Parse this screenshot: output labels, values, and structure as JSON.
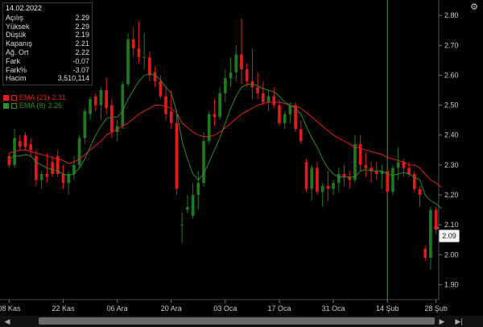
{
  "chart_data": {
    "type": "candlestick",
    "x_tick_labels": [
      "08 Kas",
      "22 Kas",
      "06 Ara",
      "20 Ara",
      "03 Oca",
      "17 Oca",
      "31 Oca",
      "14 Şub",
      "28 Şub"
    ],
    "y_ticks": [
      1.9,
      2.0,
      2.1,
      2.2,
      2.3,
      2.4,
      2.5,
      2.6,
      2.7,
      2.8
    ],
    "ylim": [
      1.85,
      2.83
    ],
    "grid": false,
    "up_color": "#1f7a1f",
    "down_color": "#e01b1b",
    "series": [
      {
        "name": "EMA (21)",
        "value": "2.31",
        "color": "#e02020"
      },
      {
        "name": "EMA (8)",
        "value": "2.26",
        "color": "#2e8b2e"
      }
    ],
    "candles": [
      {
        "o": 2.33,
        "h": 2.34,
        "l": 2.29,
        "c": 2.3
      },
      {
        "o": 2.3,
        "h": 2.42,
        "l": 2.29,
        "c": 2.39
      },
      {
        "o": 2.38,
        "h": 2.4,
        "l": 2.35,
        "c": 2.36
      },
      {
        "o": 2.4,
        "h": 2.41,
        "l": 2.35,
        "c": 2.36
      },
      {
        "o": 2.37,
        "h": 2.39,
        "l": 2.33,
        "c": 2.35
      },
      {
        "o": 2.33,
        "h": 2.35,
        "l": 2.23,
        "c": 2.25
      },
      {
        "o": 2.25,
        "h": 2.28,
        "l": 2.22,
        "c": 2.27
      },
      {
        "o": 2.27,
        "h": 2.34,
        "l": 2.24,
        "c": 2.26
      },
      {
        "o": 2.31,
        "h": 2.33,
        "l": 2.26,
        "c": 2.27
      },
      {
        "o": 2.33,
        "h": 2.35,
        "l": 2.26,
        "c": 2.27
      },
      {
        "o": 2.27,
        "h": 2.3,
        "l": 2.22,
        "c": 2.24
      },
      {
        "o": 2.24,
        "h": 2.28,
        "l": 2.2,
        "c": 2.27
      },
      {
        "o": 2.27,
        "h": 2.33,
        "l": 2.25,
        "c": 2.3
      },
      {
        "o": 2.3,
        "h": 2.4,
        "l": 2.29,
        "c": 2.39
      },
      {
        "o": 2.39,
        "h": 2.49,
        "l": 2.37,
        "c": 2.48
      },
      {
        "o": 2.47,
        "h": 2.53,
        "l": 2.45,
        "c": 2.52
      },
      {
        "o": 2.53,
        "h": 2.54,
        "l": 2.48,
        "c": 2.5
      },
      {
        "o": 2.5,
        "h": 2.56,
        "l": 2.45,
        "c": 2.55
      },
      {
        "o": 2.55,
        "h": 2.59,
        "l": 2.47,
        "c": 2.49
      },
      {
        "o": 2.5,
        "h": 2.52,
        "l": 2.39,
        "c": 2.41
      },
      {
        "o": 2.41,
        "h": 2.45,
        "l": 2.38,
        "c": 2.43
      },
      {
        "o": 2.43,
        "h": 2.58,
        "l": 2.42,
        "c": 2.57
      },
      {
        "o": 2.57,
        "h": 2.74,
        "l": 2.56,
        "c": 2.72
      },
      {
        "o": 2.72,
        "h": 2.76,
        "l": 2.66,
        "c": 2.69
      },
      {
        "o": 2.69,
        "h": 2.78,
        "l": 2.64,
        "c": 2.66
      },
      {
        "o": 2.66,
        "h": 2.74,
        "l": 2.62,
        "c": 2.66
      },
      {
        "o": 2.66,
        "h": 2.68,
        "l": 2.58,
        "c": 2.6
      },
      {
        "o": 2.61,
        "h": 2.63,
        "l": 2.56,
        "c": 2.58
      },
      {
        "o": 2.58,
        "h": 2.6,
        "l": 2.52,
        "c": 2.53
      },
      {
        "o": 2.53,
        "h": 2.56,
        "l": 2.45,
        "c": 2.47
      },
      {
        "o": 2.48,
        "h": 2.55,
        "l": 2.42,
        "c": 2.44
      },
      {
        "o": 2.44,
        "h": 2.47,
        "l": 2.2,
        "c": 2.22
      },
      {
        "o": 2.1,
        "h": 2.14,
        "l": 2.04,
        "c": 2.1
      },
      {
        "o": 2.15,
        "h": 2.2,
        "l": 2.14,
        "c": 2.16
      },
      {
        "o": 2.13,
        "h": 2.24,
        "l": 2.12,
        "c": 2.2
      },
      {
        "o": 2.2,
        "h": 2.28,
        "l": 2.15,
        "c": 2.24
      },
      {
        "o": 2.24,
        "h": 2.41,
        "l": 2.23,
        "c": 2.38
      },
      {
        "o": 2.38,
        "h": 2.48,
        "l": 2.37,
        "c": 2.47
      },
      {
        "o": 2.47,
        "h": 2.52,
        "l": 2.43,
        "c": 2.46
      },
      {
        "o": 2.46,
        "h": 2.56,
        "l": 2.45,
        "c": 2.54
      },
      {
        "o": 2.54,
        "h": 2.62,
        "l": 2.51,
        "c": 2.59
      },
      {
        "o": 2.59,
        "h": 2.66,
        "l": 2.56,
        "c": 2.61
      },
      {
        "o": 2.61,
        "h": 2.7,
        "l": 2.58,
        "c": 2.67
      },
      {
        "o": 2.67,
        "h": 2.79,
        "l": 2.57,
        "c": 2.62
      },
      {
        "o": 2.62,
        "h": 2.64,
        "l": 2.56,
        "c": 2.58
      },
      {
        "o": 2.58,
        "h": 2.69,
        "l": 2.52,
        "c": 2.56
      },
      {
        "o": 2.56,
        "h": 2.61,
        "l": 2.52,
        "c": 2.54
      },
      {
        "o": 2.54,
        "h": 2.58,
        "l": 2.5,
        "c": 2.51
      },
      {
        "o": 2.51,
        "h": 2.55,
        "l": 2.48,
        "c": 2.53
      },
      {
        "o": 2.53,
        "h": 2.56,
        "l": 2.49,
        "c": 2.5
      },
      {
        "o": 2.5,
        "h": 2.52,
        "l": 2.43,
        "c": 2.44
      },
      {
        "o": 2.44,
        "h": 2.48,
        "l": 2.42,
        "c": 2.47
      },
      {
        "o": 2.47,
        "h": 2.51,
        "l": 2.44,
        "c": 2.5
      },
      {
        "o": 2.5,
        "h": 2.51,
        "l": 2.41,
        "c": 2.42
      },
      {
        "o": 2.42,
        "h": 2.45,
        "l": 2.37,
        "c": 2.38
      },
      {
        "o": 2.31,
        "h": 2.32,
        "l": 2.21,
        "c": 2.22
      },
      {
        "o": 2.22,
        "h": 2.3,
        "l": 2.18,
        "c": 2.29
      },
      {
        "o": 2.29,
        "h": 2.31,
        "l": 2.2,
        "c": 2.21
      },
      {
        "o": 2.21,
        "h": 2.24,
        "l": 2.16,
        "c": 2.23
      },
      {
        "o": 2.23,
        "h": 2.28,
        "l": 2.18,
        "c": 2.22
      },
      {
        "o": 2.22,
        "h": 2.25,
        "l": 2.2,
        "c": 2.24
      },
      {
        "o": 2.24,
        "h": 2.29,
        "l": 2.21,
        "c": 2.27
      },
      {
        "o": 2.27,
        "h": 2.3,
        "l": 2.23,
        "c": 2.26
      },
      {
        "o": 2.26,
        "h": 2.28,
        "l": 2.22,
        "c": 2.25
      },
      {
        "o": 2.25,
        "h": 2.4,
        "l": 2.24,
        "c": 2.37
      },
      {
        "o": 2.37,
        "h": 2.4,
        "l": 2.28,
        "c": 2.3
      },
      {
        "o": 2.3,
        "h": 2.34,
        "l": 2.26,
        "c": 2.29
      },
      {
        "o": 2.29,
        "h": 2.31,
        "l": 2.24,
        "c": 2.28
      },
      {
        "o": 2.28,
        "h": 2.31,
        "l": 2.25,
        "c": 2.27
      },
      {
        "o": 2.27,
        "h": 2.3,
        "l": 2.22,
        "c": 2.28
      },
      {
        "o": 2.28,
        "h": 2.29,
        "l": 2.2,
        "c": 2.21
      },
      {
        "o": 2.21,
        "h": 2.3,
        "l": 2.2,
        "c": 2.29
      },
      {
        "o": 2.29,
        "h": 2.36,
        "l": 2.25,
        "c": 2.31
      },
      {
        "o": 2.31,
        "h": 2.32,
        "l": 2.26,
        "c": 2.29
      },
      {
        "o": 2.29,
        "h": 2.31,
        "l": 2.26,
        "c": 2.27
      },
      {
        "o": 2.27,
        "h": 2.28,
        "l": 2.21,
        "c": 2.22
      },
      {
        "o": 2.22,
        "h": 2.23,
        "l": 2.16,
        "c": 2.2
      },
      {
        "o": 2.02,
        "h": 2.03,
        "l": 1.98,
        "c": 1.99
      },
      {
        "o": 1.99,
        "h": 2.16,
        "l": 1.95,
        "c": 2.15
      },
      {
        "o": 2.15,
        "h": 2.16,
        "l": 2.07,
        "c": 2.09
      }
    ],
    "ema21": [
      2.34,
      2.345,
      2.35,
      2.35,
      2.345,
      2.34,
      2.335,
      2.33,
      2.325,
      2.32,
      2.315,
      2.305,
      2.31,
      2.32,
      2.335,
      2.35,
      2.365,
      2.38,
      2.4,
      2.41,
      2.42,
      2.43,
      2.44,
      2.455,
      2.47,
      2.48,
      2.49,
      2.5,
      2.5,
      2.495,
      2.49,
      2.475,
      2.44,
      2.425,
      2.41,
      2.4,
      2.395,
      2.395,
      2.4,
      2.41,
      2.425,
      2.44,
      2.455,
      2.47,
      2.48,
      2.49,
      2.5,
      2.505,
      2.51,
      2.51,
      2.51,
      2.505,
      2.5,
      2.495,
      2.49,
      2.475,
      2.46,
      2.445,
      2.43,
      2.415,
      2.4,
      2.39,
      2.38,
      2.37,
      2.36,
      2.355,
      2.35,
      2.345,
      2.34,
      2.335,
      2.325,
      2.32,
      2.315,
      2.31,
      2.3,
      2.3,
      2.29,
      2.27,
      2.25,
      2.24,
      2.225
    ],
    "ema8": [
      2.32,
      2.33,
      2.33,
      2.335,
      2.33,
      2.31,
      2.3,
      2.29,
      2.285,
      2.28,
      2.27,
      2.265,
      2.27,
      2.29,
      2.32,
      2.36,
      2.4,
      2.43,
      2.455,
      2.46,
      2.46,
      2.48,
      2.52,
      2.55,
      2.58,
      2.6,
      2.605,
      2.6,
      2.585,
      2.56,
      2.54,
      2.48,
      2.38,
      2.32,
      2.27,
      2.25,
      2.27,
      2.31,
      2.35,
      2.39,
      2.44,
      2.49,
      2.53,
      2.56,
      2.57,
      2.57,
      2.565,
      2.555,
      2.55,
      2.545,
      2.53,
      2.51,
      2.5,
      2.49,
      2.47,
      2.43,
      2.39,
      2.36,
      2.32,
      2.29,
      2.27,
      2.26,
      2.26,
      2.26,
      2.26,
      2.28,
      2.285,
      2.28,
      2.28,
      2.28,
      2.27,
      2.265,
      2.27,
      2.275,
      2.27,
      2.26,
      2.25,
      2.2,
      2.18,
      2.17,
      2.155
    ]
  },
  "info_panel": {
    "date": "14.02.2022",
    "rows": [
      {
        "label": "Açılış",
        "value": "2.29"
      },
      {
        "label": "Yüksek",
        "value": "2.29"
      },
      {
        "label": "Düşük",
        "value": "2.19"
      },
      {
        "label": "Kapanış",
        "value": "2.21"
      },
      {
        "label": "Ağ. Ort",
        "value": "2.22"
      },
      {
        "label": "Fark",
        "value": "-0.07"
      },
      {
        "label": "Fark%",
        "value": "-3.07"
      },
      {
        "label": "Hacim",
        "value": "3,510,114"
      }
    ]
  },
  "last_price_label": "2.09",
  "crosshair_x_label": "14 Şub",
  "icons": {
    "settings": "gear-icon",
    "scroll_left": "chevron-left-icon",
    "scroll_right": "chevron-right-icon",
    "scroll_end": "scroll-end-icon"
  },
  "glyphs": {
    "gear": "⚙",
    "left": "◀",
    "right": "▶",
    "end": "▶|"
  }
}
